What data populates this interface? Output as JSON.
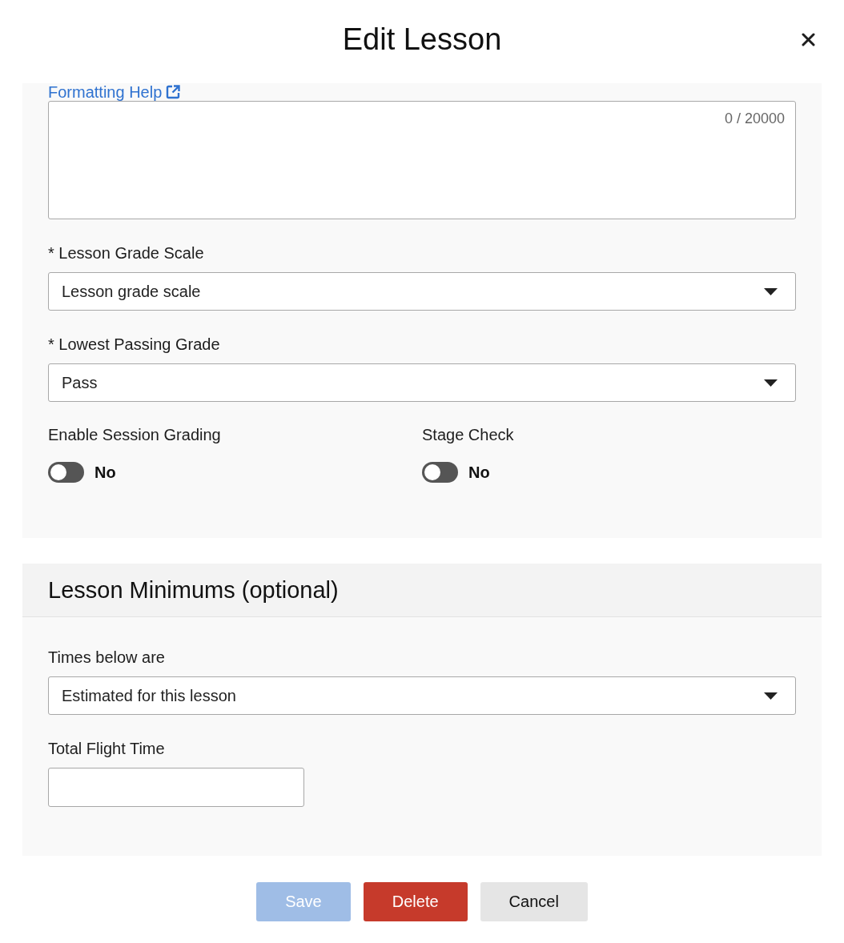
{
  "dialog": {
    "title": "Edit Lesson"
  },
  "description": {
    "help_link": "Formatting Help",
    "counter": "0 / 20000"
  },
  "fields": [
    {
      "label": "* Lesson Grade Scale",
      "kind": "select",
      "value": "Lesson grade scale"
    },
    {
      "label": "* Lowest Passing Grade",
      "kind": "select",
      "value": "Pass"
    }
  ],
  "toggles": [
    {
      "label": "Enable Session Grading",
      "on": false,
      "state_text": "No"
    },
    {
      "label": "Stage Check",
      "on": false,
      "state_text": "No"
    }
  ],
  "minimums": {
    "title": "Lesson Minimums (optional)",
    "fields": [
      {
        "label": "Times below are",
        "kind": "select",
        "value": "Estimated for this lesson"
      },
      {
        "label": "Total Flight Time",
        "kind": "text"
      }
    ]
  },
  "buttons": [
    {
      "label": "Save",
      "kind": "primary",
      "disabled": true
    },
    {
      "label": "Delete",
      "kind": "danger",
      "disabled": false
    },
    {
      "label": "Cancel",
      "kind": "secondary",
      "disabled": false
    }
  ]
}
